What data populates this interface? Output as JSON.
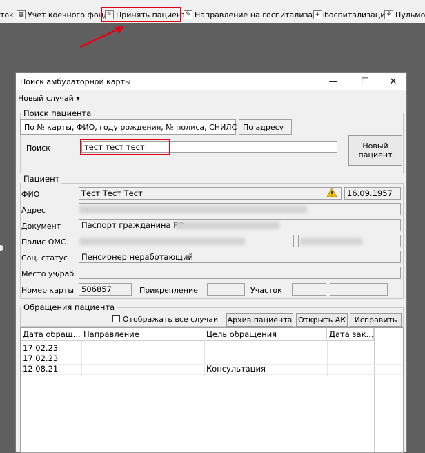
{
  "toolbar": {
    "items": [
      {
        "label": "ток"
      },
      {
        "label": "Учет коечного фонда"
      },
      {
        "label": "Принять пациента"
      },
      {
        "label": "Направление на госпитализацию"
      },
      {
        "label": "Госпитализация"
      },
      {
        "label": "Пульмо"
      }
    ]
  },
  "window": {
    "title": "Поиск амбулаторной карты",
    "minimize": "—",
    "maximize": "☐",
    "close": "✕"
  },
  "menu": {
    "new_case": "Новый случай ▾"
  },
  "search": {
    "group_title": "Поиск пациента",
    "tab_main": "По № карты, ФИО, году рождения, № полиса, СНИЛС",
    "tab_address": "По адресу",
    "label": "Поиск",
    "value": "тест тест тест",
    "new_patient_line1": "Новый",
    "new_patient_line2": "пациент"
  },
  "patient": {
    "group_title": "Пациент",
    "fio_label": "ФИО",
    "fio_value": "Тест Тест Тест",
    "birth_date": "16.09.1957",
    "address_label": "Адрес",
    "document_label": "Документ",
    "document_value": "Паспорт гражданина РФ",
    "oms_label": "Полис ОМС",
    "social_label": "Соц. статус",
    "social_value": "Пенсионер неработающий",
    "work_label": "Место уч/раб",
    "card_label": "Номер карты",
    "card_value": "506857",
    "attach_label": "Прикрепление",
    "district_label": "Участок"
  },
  "visits": {
    "group_title": "Обращения пациента",
    "show_all_label": "Отображать все случаи",
    "archive_button": "Архив пациента",
    "open_button": "Открыть АК",
    "fix_button": "Исправить",
    "columns": [
      "Дата обращ...",
      "Направление",
      "Цель обращения",
      "Дата зак..."
    ],
    "rows": [
      {
        "date": "17.02.23",
        "direction": "",
        "purpose": ""
      },
      {
        "date": "17.02.23",
        "direction": "",
        "purpose": ""
      },
      {
        "date": "12.08.21",
        "direction": "",
        "purpose": "Консультация"
      }
    ]
  },
  "colors": {
    "highlight": "#e60012",
    "background": "#5f5f5f",
    "window": "#f0f0f0"
  }
}
